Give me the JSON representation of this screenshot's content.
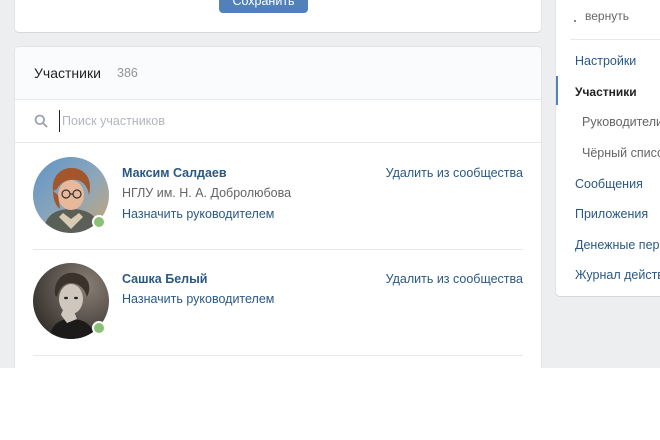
{
  "top_card": {
    "save_label": "Сохранить"
  },
  "members": {
    "title": "Участники",
    "count": "386",
    "search_placeholder": "Поиск участников",
    "list": [
      {
        "name": "Максим Салдаев",
        "subtitle": "НГЛУ им. Н. А. Добролюбова",
        "action": "Назначить руководителем",
        "remove": "Удалить из сообщества",
        "online": true
      },
      {
        "name": "Сашка Белый",
        "subtitle": "",
        "action": "Назначить руководителем",
        "remove": "Удалить из сообщества",
        "online": true
      }
    ]
  },
  "right_menu": {
    "top_text": "вернуть",
    "items": [
      {
        "label": "Настройки"
      },
      {
        "label": "Участники"
      },
      {
        "label": "Руководители"
      },
      {
        "label": "Чёрный список"
      },
      {
        "label": "Сообщения"
      },
      {
        "label": "Приложения"
      },
      {
        "label": "Денежные переводы"
      },
      {
        "label": "Журнал действий"
      }
    ]
  },
  "colors": {
    "accent": "#5181b8",
    "link": "#2a5885",
    "online": "#8ac176",
    "background": "#edeef0"
  },
  "icons": [
    "search-icon"
  ]
}
